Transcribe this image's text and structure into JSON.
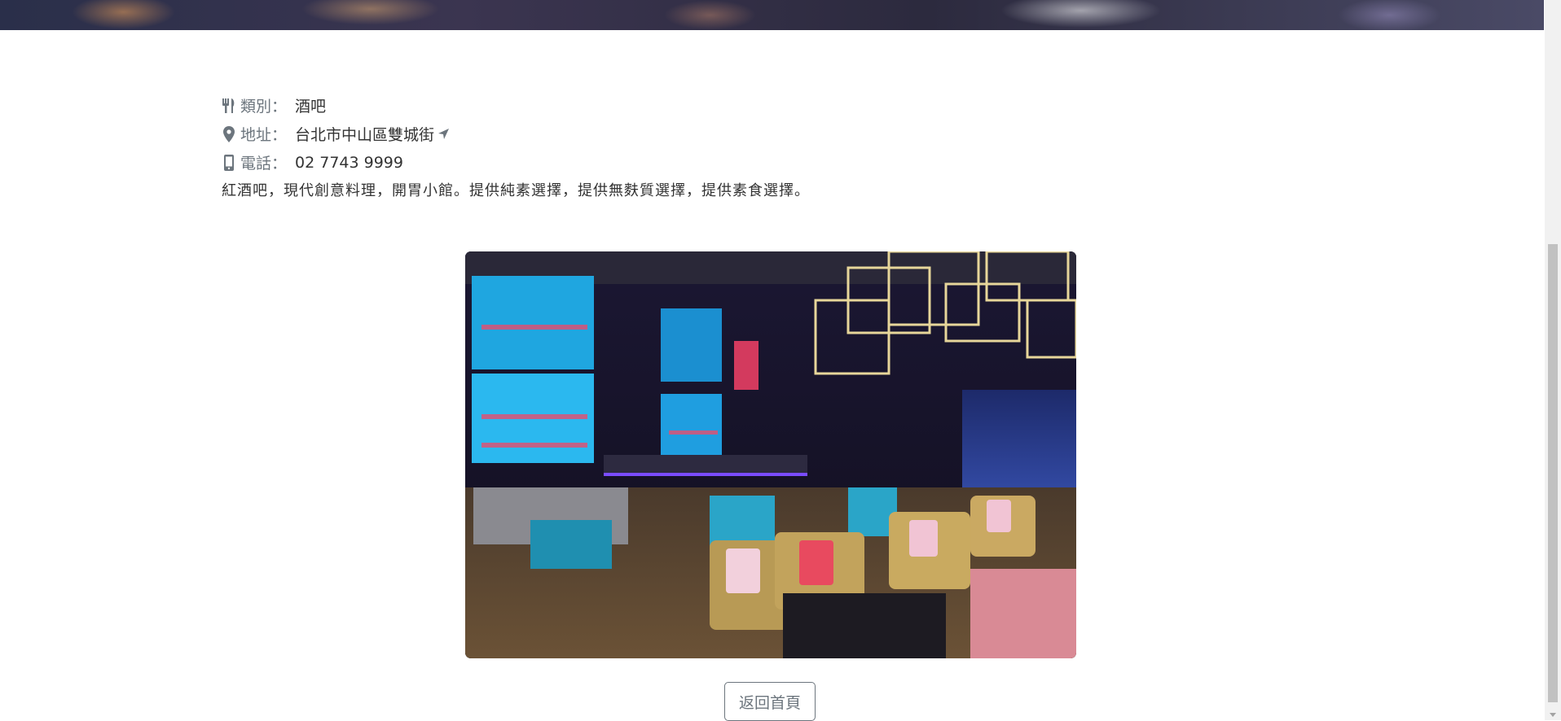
{
  "info": {
    "category_label": "類別：",
    "category_value": "酒吧",
    "address_label": "地址：",
    "address_value": "台北市中山區雙城街",
    "phone_label": "電話：",
    "phone_value": "02 7743 9999",
    "description": "紅酒吧，現代創意料理，開胃小館。提供純素選擇，提供無麩質選擇，提供素食選擇。"
  },
  "icons": {
    "category": "utensils-icon",
    "address": "map-marker-icon",
    "directions": "location-arrow-icon",
    "phone": "mobile-phone-icon"
  },
  "actions": {
    "back_label": "返回首頁"
  },
  "colors": {
    "label_gray": "#6c757d",
    "text": "#333333"
  }
}
